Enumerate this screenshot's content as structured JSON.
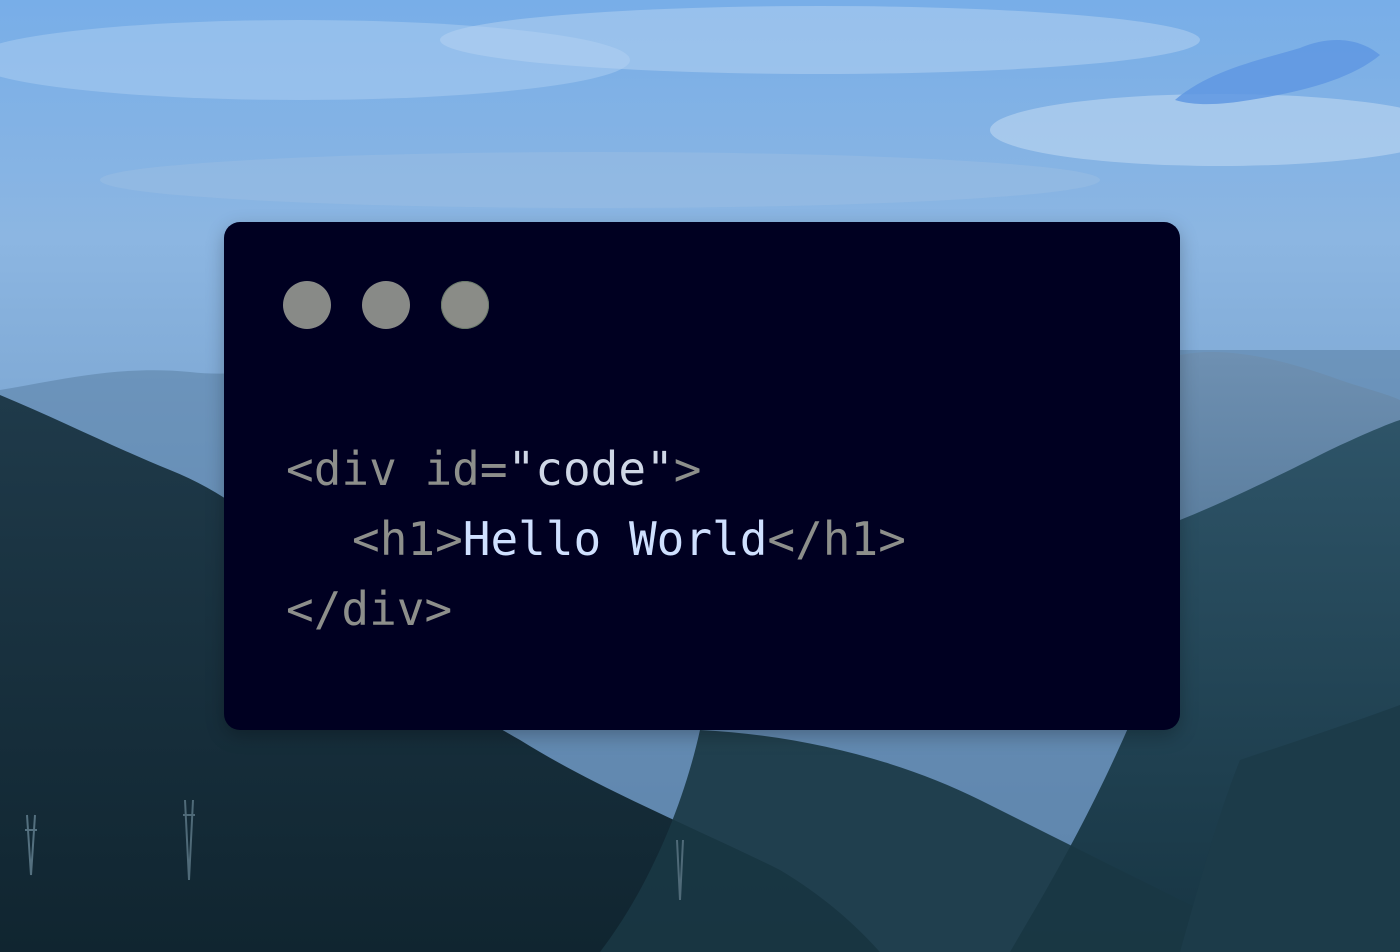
{
  "background": {
    "sky_color": "#6f9ad0",
    "mountain_color": "#17313d"
  },
  "code_window": {
    "background": "#000021",
    "window_buttons": [
      "close",
      "minimize",
      "maximize"
    ],
    "lines": {
      "line1": {
        "open": "<div id=",
        "attr_value": "\"code\"",
        "close": ">"
      },
      "line2": {
        "open_tag": "<h1>",
        "content": "Hello World",
        "close_tag": "</h1>"
      },
      "line3": {
        "close_tag": "</div>"
      }
    }
  }
}
